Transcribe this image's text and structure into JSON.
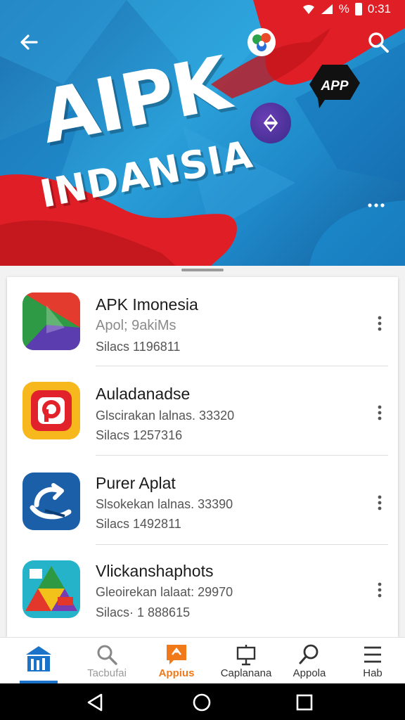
{
  "status_bar": {
    "battery_text": "%",
    "time": "0:31"
  },
  "hero": {
    "title_line1": "AIPK",
    "title_line2": "INDANSIA",
    "badge_label": "APP"
  },
  "apps": [
    {
      "name": "APK Imonesia",
      "subtitle": "Apol; 9akiMs",
      "stat": "Silacs  1196811"
    },
    {
      "name": "Auladanadse",
      "subtitle": "Glscirakan lalnas. 33320",
      "stat": "Silacs  1257316"
    },
    {
      "name": "Purer Aplat",
      "subtitle": "Slsokekan lalnas. 33390",
      "stat": "Silacs  1492811"
    },
    {
      "name": "Vlickanshaphots",
      "subtitle": "Gleoirekan lalaat: 29970",
      "stat": "Silacs· 1 888615"
    }
  ],
  "bottom_nav": [
    {
      "label": "",
      "icon": "home-icon",
      "active": true
    },
    {
      "label": "Tacbufai",
      "icon": "search-icon",
      "active": false
    },
    {
      "label": "Appius",
      "icon": "apps-icon",
      "active": false
    },
    {
      "label": "Caplanana",
      "icon": "board-icon",
      "active": false
    },
    {
      "label": "Appola",
      "icon": "magnifier-icon",
      "active": false
    },
    {
      "label": "Hab",
      "icon": "menu-icon",
      "active": false
    }
  ],
  "colors": {
    "accent": "#1a73c8",
    "nav_highlight": "#f07a1a",
    "hero_red": "#e01e26",
    "hero_blue": "#1e88c8"
  }
}
